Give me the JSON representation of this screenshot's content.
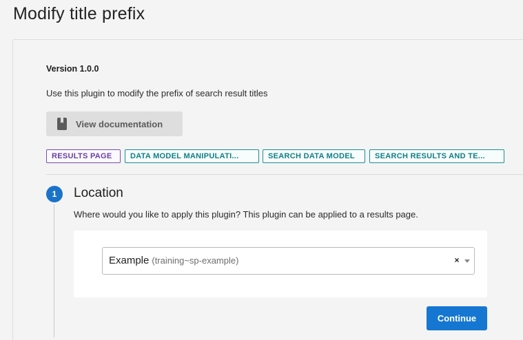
{
  "page": {
    "title": "Modify title prefix"
  },
  "plugin": {
    "version": "Version 1.0.0",
    "description": "Use this plugin to modify the prefix of search result titles",
    "doc_button_label": "View documentation",
    "tags": [
      {
        "label": "RESULTS PAGE",
        "color": "#6a3ea1"
      },
      {
        "label": "DATA MODEL MANIPULATI...",
        "color": "#0f7f86"
      },
      {
        "label": "SEARCH DATA MODEL",
        "color": "#0f7f86"
      },
      {
        "label": "SEARCH RESULTS AND TE...",
        "color": "#0f7f86"
      }
    ]
  },
  "step": {
    "number": "1",
    "title": "Location",
    "description": "Where would you like to apply this plugin? This plugin can be applied to a results page.",
    "select": {
      "value": "Example",
      "value_detail": "(training~sp-example)",
      "clear_glyph": "×"
    },
    "continue_label": "Continue"
  },
  "colors": {
    "accent": "#1577d1",
    "tag_purple": "#6a3ea1",
    "tag_teal": "#0f7f86"
  }
}
